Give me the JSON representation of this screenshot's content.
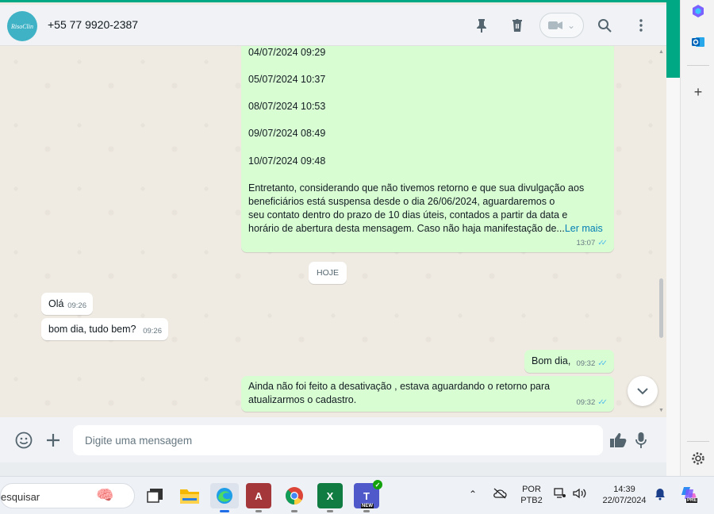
{
  "header": {
    "avatar_text": "RisoClin",
    "contact_name": "+55 77 9920-2387"
  },
  "messages": {
    "m1": {
      "lines": [
        "04/07/2024 09:29",
        "05/07/2024 10:37",
        "08/07/2024 10:53",
        "09/07/2024 08:49",
        "10/07/2024 09:48"
      ],
      "paragraph": [
        "Entretanto, considerando que não tivemos retorno e que sua divulgação aos",
        "beneficiários está suspensa desde o dia 26/06/2024, aguardaremos o",
        "seu contato dentro do prazo de 10 dias úteis, contados a partir da data e",
        "horário de abertura desta mensagem. Caso não haja manifestação de..."
      ],
      "read_more": "Ler mais",
      "time": "13:07"
    },
    "day_divider": "HOJE",
    "m2": {
      "text": "Olá",
      "time": "09:26"
    },
    "m3": {
      "text": "bom dia, tudo bem?",
      "time": "09:26"
    },
    "m4": {
      "text": "Bom dia,",
      "time": "09:32"
    },
    "m5": {
      "lines": [
        "Ainda não foi feito a desativação , estava aguardando o retorno para",
        "atualizarmos o cadastro."
      ],
      "time": "09:32"
    }
  },
  "composer": {
    "placeholder": "Digite uma mensagem"
  },
  "taskbar": {
    "search_text": "esquisar",
    "lang_top": "POR",
    "lang_bottom": "PTB2",
    "clock_time": "14:39",
    "clock_date": "22/07/2024",
    "teams_badge": "NEW",
    "copilot_badge": "PRE"
  },
  "colors": {
    "accent": "#00a884",
    "outgoing_bubble": "#d9fdd3",
    "incoming_bubble": "#ffffff",
    "read_ticks": "#53bdeb",
    "link": "#027eb5"
  }
}
